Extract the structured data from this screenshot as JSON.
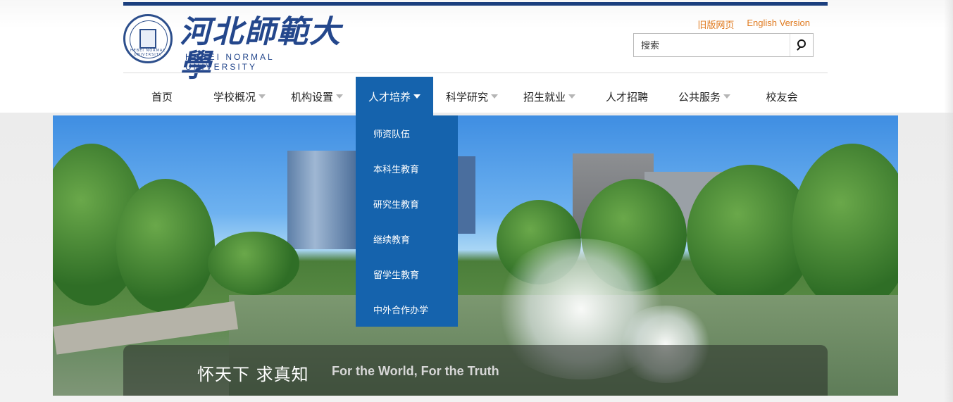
{
  "logo": {
    "name_cn": "河北師範大學",
    "name_en": "HEBEI NORMAL UNIVERSITY",
    "seal_text": "HEBEI NORMAL UNIVERSITY"
  },
  "top_links": [
    "旧版网页",
    "English Version"
  ],
  "search": {
    "placeholder": "搜索",
    "icon": "search-icon"
  },
  "nav": {
    "items": [
      {
        "label": "首页",
        "has_caret": false
      },
      {
        "label": "学校概况",
        "has_caret": true
      },
      {
        "label": "机构设置",
        "has_caret": true
      },
      {
        "label": "人才培养",
        "has_caret": true,
        "active": true
      },
      {
        "label": "科学研究",
        "has_caret": true
      },
      {
        "label": "招生就业",
        "has_caret": true
      },
      {
        "label": "人才招聘",
        "has_caret": false
      },
      {
        "label": "公共服务",
        "has_caret": true
      },
      {
        "label": "校友会",
        "has_caret": false
      }
    ]
  },
  "dropdown": {
    "items": [
      "师资队伍",
      "本科生教育",
      "研究生教育",
      "继续教育",
      "留学生教育",
      "中外合作办学"
    ]
  },
  "banner": {
    "motto_cn": "怀天下  求真知",
    "motto_en": "For the World, For the Truth"
  },
  "colors": {
    "brand_blue": "#1b3f7e",
    "nav_active": "#1563ad",
    "link_orange": "#e07a1f"
  }
}
